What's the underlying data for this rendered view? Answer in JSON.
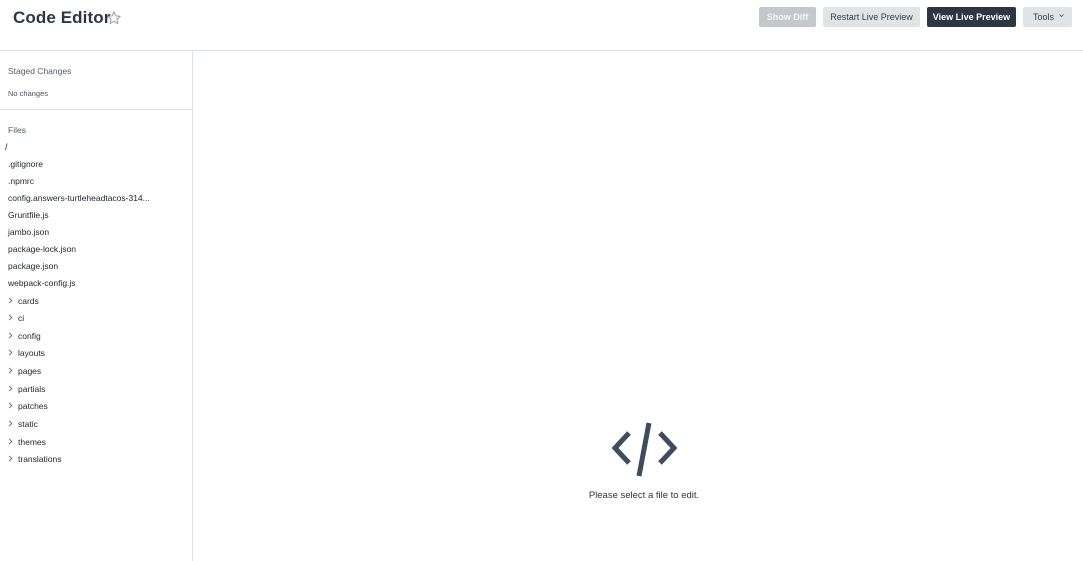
{
  "header": {
    "title": "Code Editor",
    "favorite_icon": "star-outline-icon",
    "buttons": {
      "show_diff": "Show Diff",
      "restart_live_preview": "Restart Live Preview",
      "view_live_preview": "View Live Preview",
      "tools": "Tools"
    }
  },
  "sidebar": {
    "staged": {
      "label": "Staged Changes",
      "note": "No changes"
    },
    "files": {
      "label": "Files",
      "root": "/",
      "items": [
        ".gitignore",
        ".npmrc",
        "config.answers-turtleheadtacos-314...",
        "Gruntfile.js",
        "jambo.json",
        "package-lock.json",
        "package.json",
        "webpack-config.js"
      ],
      "folders": [
        "cards",
        "ci",
        "config",
        "layouts",
        "pages",
        "partials",
        "patches",
        "static",
        "themes",
        "translations"
      ]
    }
  },
  "main": {
    "empty_icon": "code-brackets-icon",
    "empty_message": "Please select a file to edit."
  },
  "colors": {
    "primary": "#2e3643",
    "border": "#dde0e4",
    "button_light": "#e1e4e7",
    "button_disabled": "#c4c8cc",
    "icon": "#3e4d5c"
  }
}
